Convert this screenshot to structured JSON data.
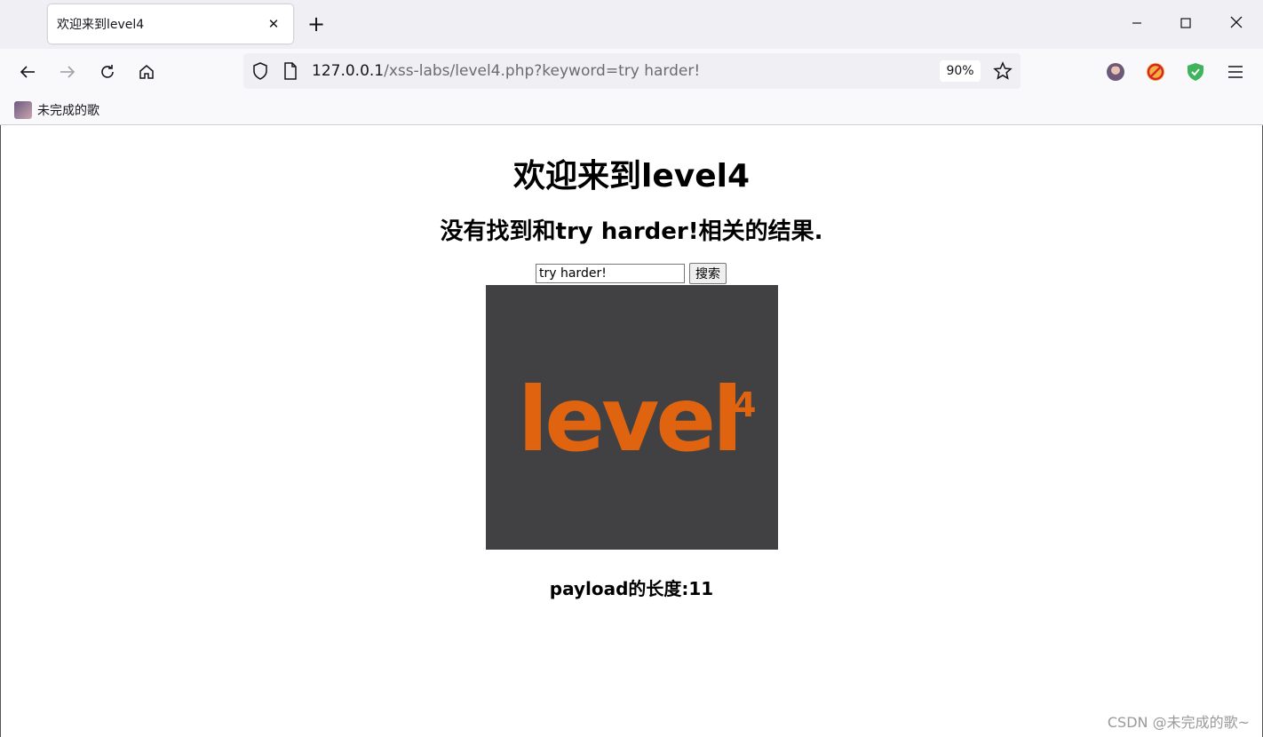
{
  "browser": {
    "tab_title": "欢迎来到level4",
    "url_host": "127.0.0.1",
    "url_path": "/xss-labs/level4.php?keyword=try harder!",
    "zoom": "90%",
    "bookmark_label": "未完成的歌"
  },
  "page": {
    "heading": "欢迎来到level4",
    "result_text": "没有找到和try harder!相关的结果.",
    "search_value": "try harder!",
    "search_button": "搜索",
    "payload_length": "payload的长度:11"
  },
  "logo": {
    "text": "level",
    "superscript": "4",
    "color": "#e0640f",
    "background": "#414143"
  },
  "watermark": "CSDN @未完成的歌~"
}
